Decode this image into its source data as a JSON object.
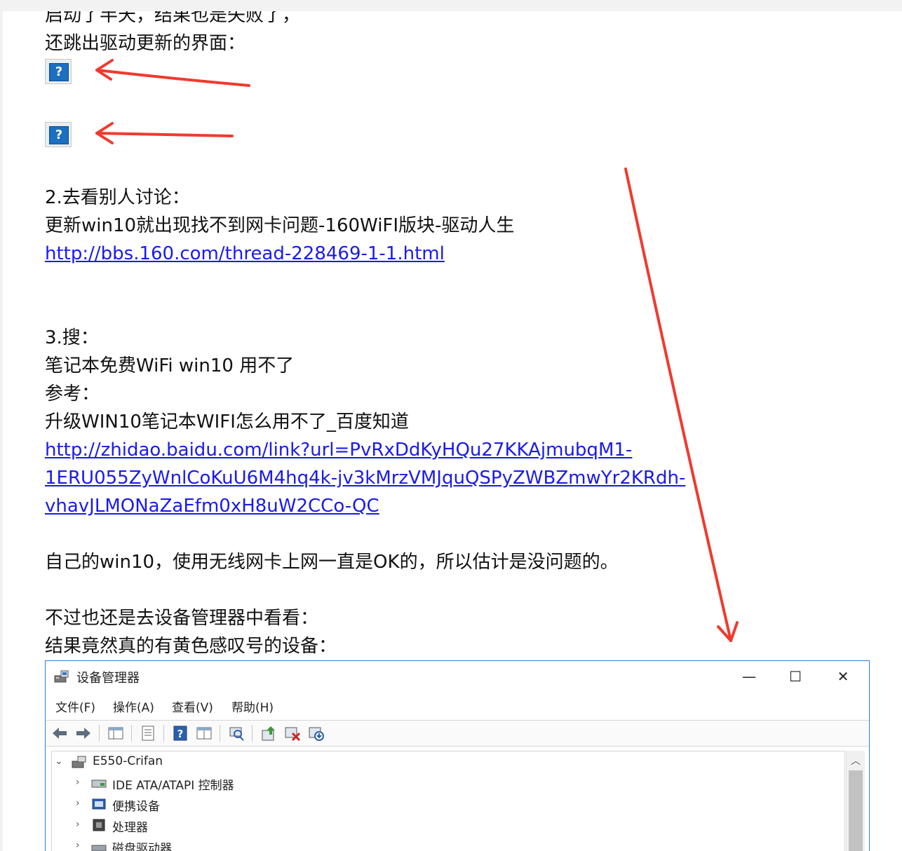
{
  "article": {
    "lines": {
      "l1": "启动了半天，结果也是失败了，",
      "l2": "还跳出驱动更新的界面：",
      "l3": "2.去看别人讨论：",
      "l4": "更新win10就出现找不到网卡问题-160WiFI版块-驱动人生",
      "link1": "http://bbs.160.com/thread-228469-1-1.html",
      "l5": "3.搜：",
      "l6": "笔记本免费WiFi win10 用不了",
      "l7": "参考：",
      "l8": "升级WIN10笔记本WIFI怎么用不了_百度知道",
      "link2a": "http://zhidao.baidu.com/link?url=PvRxDdKyHQu27KKAjmubqM1-",
      "link2b": "1ERU055ZyWnlCoKuU6M4hq4k-jv3kMrzVMJquQSPyZWBZmwYr2KRdh-",
      "link2c": "vhavJLMONaZaEfm0xH8uW2CCo-QC",
      "l9": "自己的win10，使用无线网卡上网一直是OK的，所以估计是没问题的。",
      "l10": "不过也还是去设备管理器中看看：",
      "l11": "结果竟然真的有黄色感叹号的设备："
    },
    "broken_image_glyph": "?"
  },
  "window": {
    "title": "设备管理器",
    "controls": {
      "minimize": "—",
      "maximize": "☐",
      "close": "✕"
    },
    "menu": [
      "文件(F)",
      "操作(A)",
      "查看(V)",
      "帮助(H)"
    ],
    "toolbar_icons": [
      "back-icon",
      "forward-icon",
      "properties-pane-icon",
      "properties-icon",
      "help-icon",
      "view-icon",
      "scan-hardware-icon",
      "update-driver-icon",
      "uninstall-device-icon",
      "disable-device-icon"
    ],
    "tree": {
      "root": "E550-Crifan",
      "items": [
        "IDE ATA/ATAPI 控制器",
        "便携设备",
        "处理器",
        "磁盘驱动器"
      ]
    }
  },
  "colors": {
    "annotation_arrow": "#f03a2e",
    "link": "#1a1aee",
    "window_border": "#2b7de1"
  }
}
